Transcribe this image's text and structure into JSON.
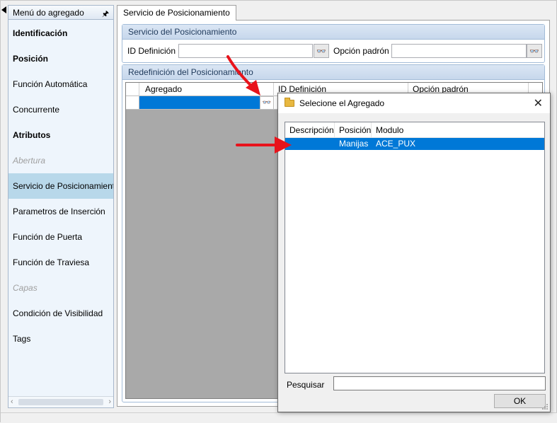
{
  "left_menu": {
    "header": "Menú do agregado",
    "items": [
      {
        "label": "Identificación",
        "style": "bold"
      },
      {
        "label": "Posición",
        "style": "bold"
      },
      {
        "label": "Función Automática",
        "style": "normal"
      },
      {
        "label": "Concurrente",
        "style": "normal"
      },
      {
        "label": "Atributos",
        "style": "bold"
      },
      {
        "label": "Abertura",
        "style": "disabled"
      },
      {
        "label": "Servicio de Posicionamiento",
        "style": "selected"
      },
      {
        "label": "Parametros de Inserción",
        "style": "normal"
      },
      {
        "label": "Función de Puerta",
        "style": "normal"
      },
      {
        "label": "Función de Traviesa",
        "style": "normal"
      },
      {
        "label": "Capas",
        "style": "disabled"
      },
      {
        "label": "Condición de Visibilidad",
        "style": "normal"
      },
      {
        "label": "Tags",
        "style": "normal"
      }
    ]
  },
  "tab": {
    "label": "Servicio de Posicionamiento"
  },
  "group1": {
    "title": "Servicio del Posicionamiento",
    "id_label": "ID Definición",
    "option_label": "Opción padrón",
    "id_value": "",
    "option_value": ""
  },
  "group2": {
    "title": "Redefinición del Posicionamiento",
    "columns": [
      "Agregado",
      "ID Definición",
      "Opción padrón"
    ]
  },
  "dialog": {
    "title": "Selecione el Agregado",
    "columns": [
      "Descripción",
      "Posición",
      "Modulo"
    ],
    "rows": [
      {
        "descripcion": "",
        "posicion": "Manijas",
        "modulo": "ACE_PUX"
      }
    ],
    "search_label": "Pesquisar",
    "search_value": "",
    "ok_label": "OK"
  },
  "colors": {
    "selection": "#0078d7",
    "menu_selected": "#b8d8ea",
    "group_header": "#c7d7ec",
    "annotation_arrow": "#e8131b"
  }
}
